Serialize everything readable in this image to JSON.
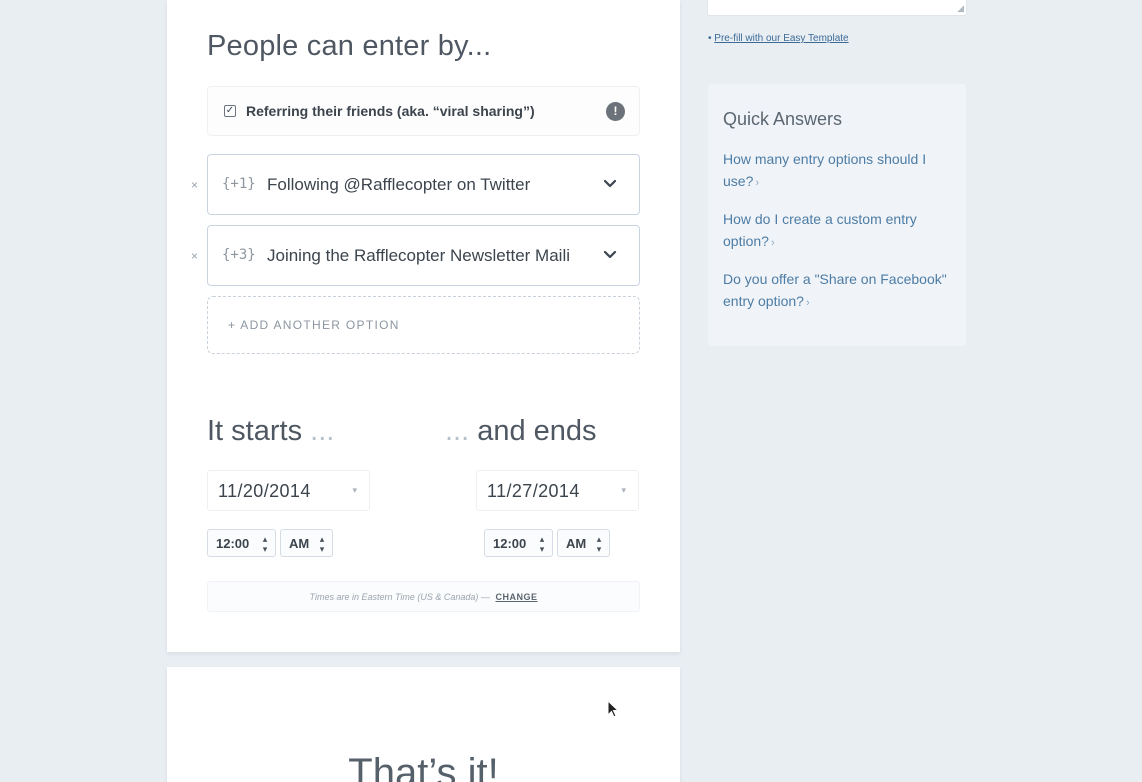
{
  "entry_section": {
    "title": "People can enter by...",
    "viral": {
      "checkbox_mark": "✓",
      "label": "Referring their friends (aka. “viral sharing”)",
      "info_glyph": "!"
    },
    "remove_glyph": "×",
    "options": [
      {
        "points": "{+1}",
        "label": "Following @Rafflecopter on Twitter"
      },
      {
        "points": "{+3}",
        "label": "Joining the Rafflecopter Newsletter Maili"
      }
    ],
    "add_option_label": "+ ADD ANOTHER OPTION"
  },
  "dates": {
    "start_heading": "It starts",
    "start_dots": " ...",
    "end_dots": "... ",
    "end_heading": "and ends",
    "start_date": "11/20/2014",
    "end_date": "11/27/2014",
    "date_caret": "▾",
    "start_time": "12:00",
    "start_ampm": "AM",
    "end_time": "12:00",
    "end_ampm": "AM",
    "spinner_glyph": "▴▾",
    "timezone_note": "Times are in Eastern Time (US & Canada) —",
    "timezone_change": "CHANGE"
  },
  "next_section": {
    "title": "That’s it!"
  },
  "sidebar": {
    "textarea_grip": "◢",
    "prefill_bullet": "•",
    "prefill_link": "Pre-fill with our Easy Template",
    "quick_answers": {
      "title": "Quick Answers",
      "arrow": "›",
      "links": [
        "How many entry options should I use?",
        "How do I create a custom entry option?",
        "Do you offer a \"Share on Facebook\" entry option?"
      ]
    }
  }
}
